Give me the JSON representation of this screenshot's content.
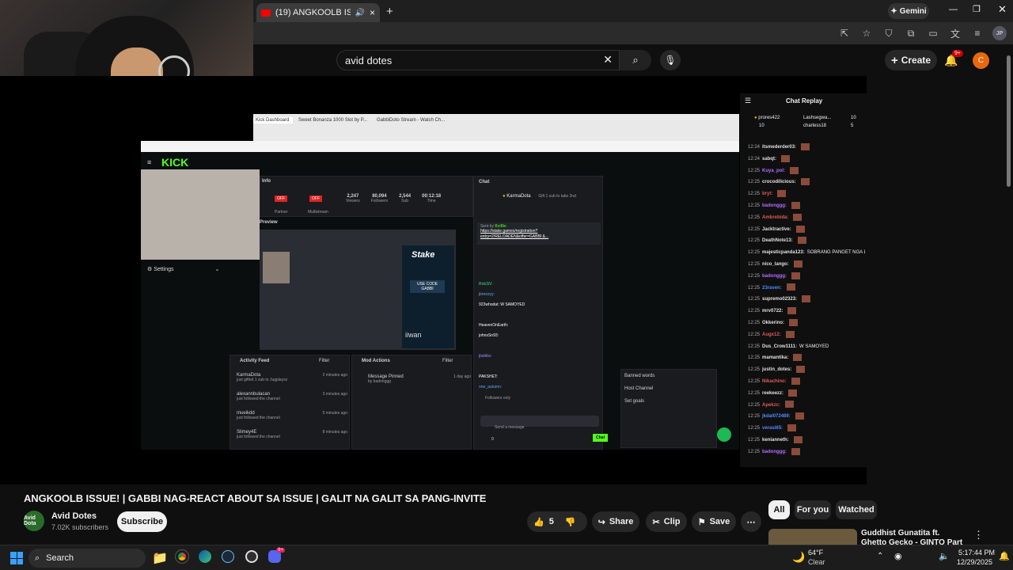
{
  "browser": {
    "tab_title": "(19) ANGKOOLB ISSUE! | GA",
    "new_tab": "+",
    "gemini_label": "Gemini",
    "profile": "JP"
  },
  "youtube": {
    "search_value": "avid dotes",
    "create_label": "Create",
    "notifications_badge": "9+",
    "account_initial": "C"
  },
  "video": {
    "inner_tabs": [
      "Kick Dashboard",
      "Sweet Bonanza 1000 Slot by P...",
      "GabbiDoto Stream - Watch Ch..."
    ],
    "kick_logo": "KICK",
    "settings_label": "Settings",
    "info_label": "Info",
    "preview_label": "Preview",
    "stats": [
      {
        "value": "2,247",
        "label": "Viewers"
      },
      {
        "value": "80,094",
        "label": "Followers"
      },
      {
        "value": "2,544",
        "label": "Sub"
      },
      {
        "value": "00:12:18",
        "label": "Time"
      }
    ],
    "badges": [
      "OFF",
      "OFF"
    ],
    "badge_labels": [
      "Partner",
      "Multistream"
    ],
    "preview_caption": "iiwan",
    "activity_title": "Activity Feed",
    "mod_title": "Mod Actions",
    "filter_label": "Filter",
    "activity": [
      {
        "user": "KarmaDota",
        "text": "just gifted 1 sub to Jugplaysz",
        "time": "2 minutes ago"
      },
      {
        "user": "alexannbulacan",
        "text": "just followed the channel",
        "time": "3 minutes ago"
      },
      {
        "user": "mueikdd",
        "text": "just followed the channel",
        "time": "5 minutes ago"
      },
      {
        "user": "Slimey4E",
        "text": "just followed the channel",
        "time": "8 minutes ago"
      }
    ],
    "mod_item": {
      "title": "Message Pinned",
      "by": "by badonggg",
      "time": "1 day ago"
    },
    "kchat_title": "Chat",
    "gift_user": "KarmaDota",
    "gift_text": "Gift 1 sub to take 2nd",
    "pinned_by": "Sent by",
    "pinned_user": "BoiBie",
    "pinned_link": "https://stake.games/registration?entry=2!RELOADEN&offer=GABBI &...",
    "kchat_lines": [
      "RickSV:",
      "jbreezyy:",
      "923whodat: W SAMOYED",
      "HeavenOnEarth:",
      "johnsSn93:",
      "jbsibbs",
      "PAKSHET:",
      "one_autumn:"
    ],
    "followers_only": "Followers only",
    "send_placeholder": "Send a message",
    "chat_button": "Chat",
    "menu_items": [
      "Banned words",
      "Host Channel",
      "Set goals"
    ],
    "stake_text": "Stake",
    "stake_code": "USE CODE GABBI",
    "counter": "0"
  },
  "chat_replay": {
    "title": "Chat Replay",
    "top_donors": [
      {
        "name": "prores422",
        "amount": "10"
      },
      {
        "name": "Lashsegwa...",
        "amount": "10"
      },
      {
        "name": "charless18",
        "amount": "5"
      }
    ],
    "lines": [
      {
        "time": "12:24",
        "user": "itsmederder03:",
        "color": "#e0e0e0",
        "msg": ""
      },
      {
        "time": "12:24",
        "user": "sabqt:",
        "color": "#e0e0e0",
        "msg": ""
      },
      {
        "time": "12:25",
        "user": "Kuya_pol:",
        "color": "#b36bff",
        "msg": ""
      },
      {
        "time": "12:25",
        "user": "crocodilicious:",
        "color": "#e0e0e0",
        "msg": ""
      },
      {
        "time": "12:25",
        "user": "bryt:",
        "color": "#e05a5a",
        "msg": ""
      },
      {
        "time": "12:25",
        "user": "badonggg:",
        "color": "#b36bff",
        "msg": ""
      },
      {
        "time": "12:25",
        "user": "Ambrebida:",
        "color": "#e05a5a",
        "msg": ""
      },
      {
        "time": "12:25",
        "user": "Jacktractive:",
        "color": "#e0e0e0",
        "msg": ""
      },
      {
        "time": "12:25",
        "user": "DeathNote13:",
        "color": "#e0e0e0",
        "msg": ""
      },
      {
        "time": "12:25",
        "user": "majesticpanda123:",
        "color": "#e0e0e0",
        "msg": "SOBRANG PANGET NGA LANG GAB NO?"
      },
      {
        "time": "12:25",
        "user": "nico_lango:",
        "color": "#e0e0e0",
        "msg": ""
      },
      {
        "time": "12:25",
        "user": "badonggg:",
        "color": "#b36bff",
        "msg": ""
      },
      {
        "time": "12:25",
        "user": "23raven:",
        "color": "#4d8cff",
        "msg": ""
      },
      {
        "time": "12:25",
        "user": "supremo02323:",
        "color": "#e0e0e0",
        "msg": ""
      },
      {
        "time": "12:25",
        "user": "mrv0722:",
        "color": "#e0e0e0",
        "msg": ""
      },
      {
        "time": "12:25",
        "user": "Okkerino:",
        "color": "#e0e0e0",
        "msg": ""
      },
      {
        "time": "12:25",
        "user": "Augx12:",
        "color": "#e05a5a",
        "msg": ""
      },
      {
        "time": "12:25",
        "user": "Dus_Crow1111:",
        "color": "#e0e0e0",
        "msg": "W SAMOYED"
      },
      {
        "time": "12:25",
        "user": "mamantika:",
        "color": "#e0e0e0",
        "msg": ""
      },
      {
        "time": "12:25",
        "user": "justin_dotes:",
        "color": "#e0e0e0",
        "msg": ""
      },
      {
        "time": "12:25",
        "user": "Nikachino:",
        "color": "#e05a5a",
        "msg": ""
      },
      {
        "time": "12:25",
        "user": "reekeezz:",
        "color": "#e0e0e0",
        "msg": ""
      },
      {
        "time": "12:25",
        "user": "Apekzc:",
        "color": "#e05a5a",
        "msg": ""
      },
      {
        "time": "12:25",
        "user": "jkdal072489:",
        "color": "#4d8cff",
        "msg": ""
      },
      {
        "time": "12:25",
        "user": "verasi65:",
        "color": "#4d8cff",
        "msg": ""
      },
      {
        "time": "12:25",
        "user": "kenianneth:",
        "color": "#e0e0e0",
        "msg": ""
      },
      {
        "time": "12:25",
        "user": "badonggg:",
        "color": "#b36bff",
        "msg": ""
      }
    ]
  },
  "watch": {
    "title": "ANGKOOLB ISSUE! | GABBI NAG-REACT ABOUT SA ISSUE | GALIT NA GALIT SA PANG-INVITE",
    "channel_name": "Avid Dotes",
    "subscribers": "7.02K subscribers",
    "subscribe_label": "Subscribe",
    "avatar_text": "Avid Dota",
    "like_count": "5",
    "share_label": "Share",
    "clip_label": "Clip",
    "save_label": "Save",
    "chips": [
      "All",
      "For you",
      "Watched"
    ],
    "rec_title": "Guddhist Gunatita ft. Ghetto Gecko - GINTO Part 2 (Official"
  },
  "taskbar": {
    "search_label": "Search",
    "weather_temp": "64°F",
    "weather_desc": "Clear",
    "time": "5:17:44 PM",
    "date": "12/29/2025",
    "discord_badge": "9+"
  },
  "colors": {
    "kick_green": "#53fc18",
    "yt_red": "#ff0000",
    "create_bg": "#272727"
  }
}
